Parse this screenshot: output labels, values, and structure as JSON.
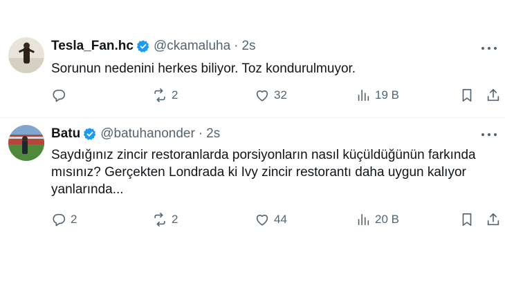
{
  "tweets": [
    {
      "name": "Tesla_Fan.hc",
      "handle": "@ckamaluha",
      "dot": "·",
      "time": "2s",
      "text": "Sorunun nedenini herkes biliyor. Toz kondurulmuyor.",
      "replies": "",
      "retweets": "2",
      "likes": "32",
      "views": "19 B"
    },
    {
      "name": "Batu",
      "handle": "@batuhanonder",
      "dot": "·",
      "time": "2s",
      "text": "Saydığınız zincir restoranlarda porsiyonların nasıl küçüldüğünün farkında mısınız? Gerçekten Londrada ki Ivy zincir restorantı daha uygun kalıyor yanlarında...",
      "replies": "2",
      "retweets": "2",
      "likes": "44",
      "views": "20 B"
    }
  ],
  "colors": {
    "text": "#0f1419",
    "muted": "#536471",
    "verified": "#1d9bf0",
    "divider": "#eff3f4"
  },
  "icons": [
    "verified-badge-icon",
    "more-icon",
    "reply-icon",
    "retweet-icon",
    "like-icon",
    "views-icon",
    "bookmark-icon",
    "share-icon"
  ]
}
